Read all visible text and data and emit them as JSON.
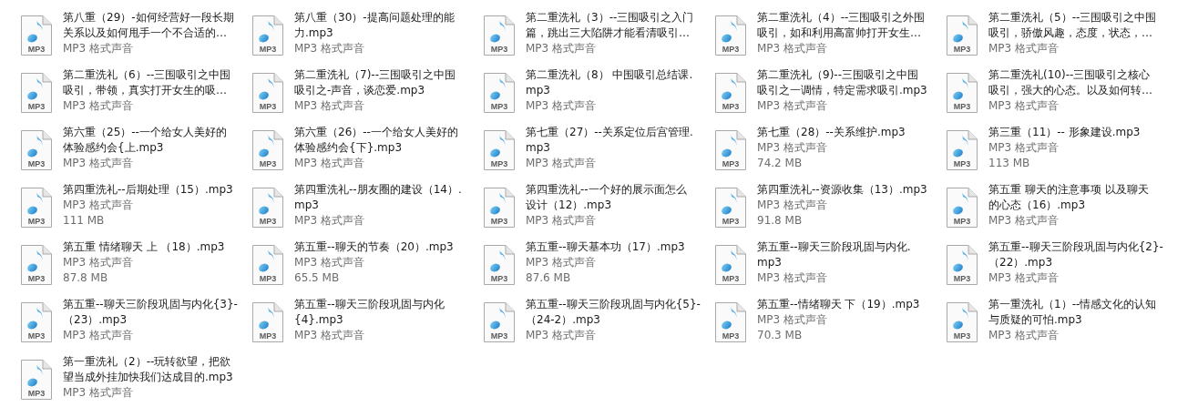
{
  "files": [
    {
      "name_lines": [
        "第八重（29）-如何经营好一段长期",
        "关系以及如何甩手一个不合适的…"
      ],
      "icon_label": "MP3",
      "type": "MP3 格式声音"
    },
    {
      "name_lines": [
        "第八重（30）-提高问题处理的能",
        "力.mp3"
      ],
      "icon_label": "MP3",
      "type": "MP3 格式声音"
    },
    {
      "name_lines": [
        "第二重洗礼（3）--三围吸引之入门",
        "篇，跳出三大陷阱才能看清吸引…"
      ],
      "icon_label": "MP3",
      "type": "MP3 格式声音"
    },
    {
      "name_lines": [
        "第二重洗礼（4）--三围吸引之外围",
        "吸引，如和利用高富帅打开女生…"
      ],
      "icon_label": "MP3",
      "type": "MP3 格式声音"
    },
    {
      "name_lines": [
        "第二重洗礼（5）--三围吸引之中围",
        "吸引，骄傲风趣，态度，状态，…"
      ],
      "icon_label": "MP3",
      "type": "MP3 格式声音"
    },
    {
      "name_lines": [
        "第二重洗礼（6）--三围吸引之中围",
        "吸引，带领，真实打开女生的吸…"
      ],
      "icon_label": "MP3",
      "type": "MP3 格式声音"
    },
    {
      "name_lines": [
        "第二重洗礼（7)--三围吸引之中围",
        "吸引之-声音，谈恋爱.mp3"
      ],
      "icon_label": "MP3",
      "type": "MP3 格式声音"
    },
    {
      "name_lines": [
        "第二重洗礼（8） 中围吸引总结课.",
        "mp3"
      ],
      "icon_label": "MP3",
      "type": "MP3 格式声音"
    },
    {
      "name_lines": [
        "第二重洗礼（9)--三围吸引之中围",
        "吸引之一调情，特定需求吸引.mp3"
      ],
      "icon_label": "MP3",
      "type": "MP3 格式声音"
    },
    {
      "name_lines": [
        "第二重洗礼(10)--三围吸引之核心",
        "吸引，强大的心态。以及如何转…"
      ],
      "icon_label": "MP3",
      "type": "MP3 格式声音"
    },
    {
      "name_lines": [
        "第六重（25）--一个给女人美好的",
        "体验感约会{上.mp3"
      ],
      "icon_label": "MP3",
      "type": "MP3 格式声音"
    },
    {
      "name_lines": [
        "第六重（26）--一个给女人美好的",
        "体验感约会{下}.mp3"
      ],
      "icon_label": "MP3",
      "type": "MP3 格式声音"
    },
    {
      "name_lines": [
        "第七重（27）--关系定位后宫管理.",
        "mp3"
      ],
      "icon_label": "MP3",
      "type": "MP3 格式声音"
    },
    {
      "name_lines": [
        "第七重（28）--关系维护.mp3"
      ],
      "icon_label": "MP3",
      "type": "MP3 格式声音",
      "size": "74.2 MB"
    },
    {
      "name_lines": [
        "第三重（11）-- 形象建设.mp3"
      ],
      "icon_label": "MP3",
      "type": "MP3 格式声音",
      "size": "113 MB"
    },
    {
      "name_lines": [
        "第四重洗礼--后期处理（15）.mp3"
      ],
      "icon_label": "MP3",
      "type": "MP3 格式声音",
      "size": "111 MB"
    },
    {
      "name_lines": [
        "第四重洗礼--朋友圈的建设（14）.",
        "mp3"
      ],
      "icon_label": "MP3",
      "type": "MP3 格式声音"
    },
    {
      "name_lines": [
        "第四重洗礼--一个好的展示面怎么",
        "设计（12）.mp3"
      ],
      "icon_label": "MP3",
      "type": "MP3 格式声音"
    },
    {
      "name_lines": [
        "第四重洗礼--资源收集（13）.mp3"
      ],
      "icon_label": "MP3",
      "type": "MP3 格式声音",
      "size": "91.8 MB"
    },
    {
      "name_lines": [
        "第五重 聊天的注意事项 以及聊天",
        "的心态（16）.mp3"
      ],
      "icon_label": "MP3",
      "type": "MP3 格式声音"
    },
    {
      "name_lines": [
        "第五重 情绪聊天 上 （18）.mp3"
      ],
      "icon_label": "MP3",
      "type": "MP3 格式声音",
      "size": "87.8 MB"
    },
    {
      "name_lines": [
        "第五重--聊天的节奏（20）.mp3"
      ],
      "icon_label": "MP3",
      "type": "MP3 格式声音",
      "size": "65.5 MB"
    },
    {
      "name_lines": [
        "第五重--聊天基本功（17）.mp3"
      ],
      "icon_label": "MP3",
      "type": "MP3 格式声音",
      "size": "87.6 MB"
    },
    {
      "name_lines": [
        "第五重--聊天三阶段巩固与内化.",
        "mp3"
      ],
      "icon_label": "MP3",
      "type": "MP3 格式声音"
    },
    {
      "name_lines": [
        "第五重--聊天三阶段巩固与内化{2}-",
        "（22）.mp3"
      ],
      "icon_label": "MP3",
      "type": "MP3 格式声音"
    },
    {
      "name_lines": [
        "第五重--聊天三阶段巩固与内化{3}-",
        "（23）.mp3"
      ],
      "icon_label": "MP3",
      "type": "MP3 格式声音"
    },
    {
      "name_lines": [
        "第五重--聊天三阶段巩固与内化",
        "{4}.mp3"
      ],
      "icon_label": "MP3",
      "type": "MP3 格式声音"
    },
    {
      "name_lines": [
        "第五重--聊天三阶段巩固与内化{5}-",
        "（24-2）.mp3"
      ],
      "icon_label": "MP3",
      "type": "MP3 格式声音"
    },
    {
      "name_lines": [
        "第五重--情绪聊天 下（19）.mp3"
      ],
      "icon_label": "MP3",
      "type": "MP3 格式声音",
      "size": "70.3 MB"
    },
    {
      "name_lines": [
        "第一重洗礼（1）--情感文化的认知",
        "与质疑的可怕.mp3"
      ],
      "icon_label": "MP3",
      "type": "MP3 格式声音"
    },
    {
      "name_lines": [
        "第一重洗礼（2）--玩转欲望，把欲",
        "望当成外挂加快我们达成目的.mp3"
      ],
      "icon_label": "MP3",
      "type": "MP3 格式声音"
    }
  ]
}
